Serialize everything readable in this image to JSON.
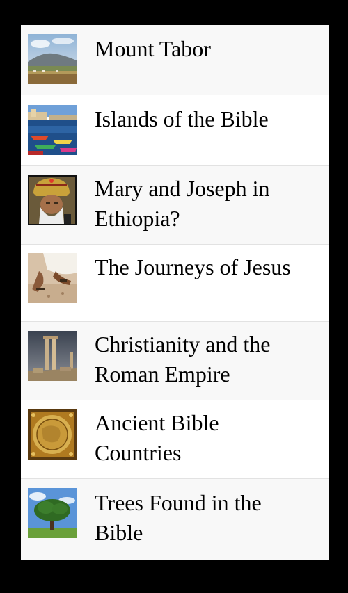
{
  "list": {
    "items": [
      {
        "label": "Mount Tabor",
        "icon": "mountain-landscape-thumbnail"
      },
      {
        "label": "Islands of the Bible",
        "icon": "harbor-boats-thumbnail"
      },
      {
        "label": "Mary and Joseph in\nEthiopia?",
        "icon": "patriarch-portrait-thumbnail"
      },
      {
        "label": "The Journeys of Jesus",
        "icon": "sandaled-feet-thumbnail"
      },
      {
        "label": "Christianity and the\nRoman Empire",
        "icon": "roman-columns-thumbnail"
      },
      {
        "label": "Ancient Bible\nCountries",
        "icon": "ancient-map-thumbnail"
      },
      {
        "label": "Trees Found in the\nBible",
        "icon": "tree-thumbnail"
      }
    ]
  },
  "colors": {
    "background": "#000000",
    "list_bg": "#ffffff",
    "alt_row_bg": "#f8f8f8",
    "divider": "#e2e2e2",
    "text": "#000000"
  }
}
